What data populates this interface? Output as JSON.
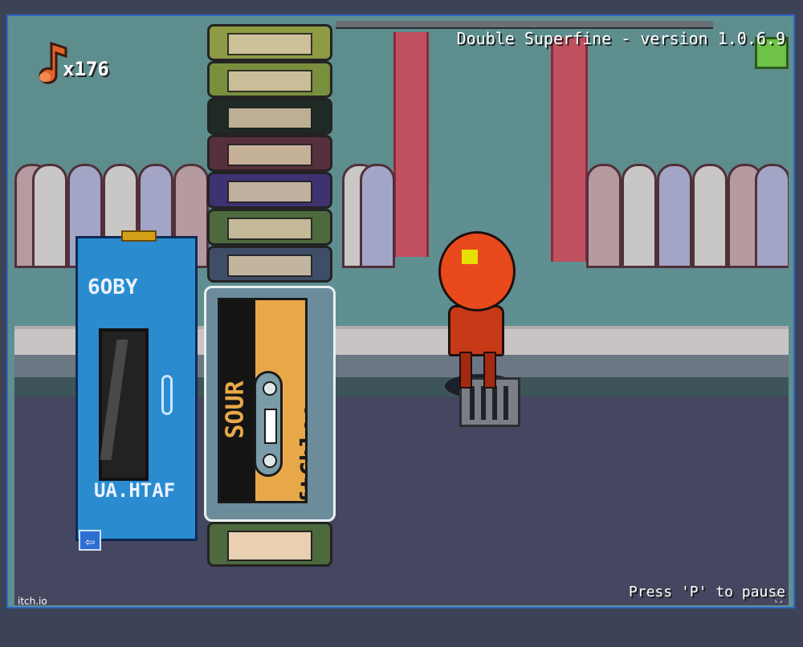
{
  "game": {
    "title": "Double Superfine - version 1.0.6.9",
    "note_count": "x176",
    "pause_hint": "Press 'P' to pause",
    "platform_label": "itch.io",
    "fullscreen_icon": "fullscreen-icon",
    "back_icon": "arrow-left-icon"
  },
  "walkman": {
    "brand": "6OBY",
    "model": "UA.HTAF"
  },
  "tapes": [
    {
      "color": "#8f9a45"
    },
    {
      "color": "#7a8f3d"
    },
    {
      "color": "#1f2a25"
    },
    {
      "color": "#57303e"
    },
    {
      "color": "#3e3270"
    },
    {
      "color": "#4d6a3f"
    },
    {
      "color": "#3f4e66"
    }
  ],
  "selected_tape": {
    "label_left": "SOUR",
    "label_right": "ftChloe Berry",
    "color": "#e8a84a"
  },
  "colors": {
    "frame_border": "#2e67c9",
    "player_red": "#e84a1c",
    "walkman_blue": "#2a8ccf"
  }
}
